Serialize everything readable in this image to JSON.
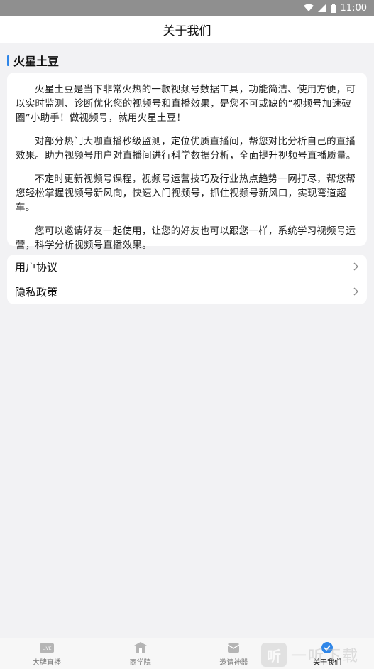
{
  "status_bar": {
    "time": "11:00",
    "icons": [
      "wifi-icon",
      "signal-icon",
      "battery-icon"
    ]
  },
  "header": {
    "title": "关于我们"
  },
  "section": {
    "title": "火星土豆",
    "accent_color": "#2f86e8"
  },
  "about": {
    "paragraphs": [
      "火星土豆是当下非常火热的一款视频号数据工具，功能简洁、使用方便，可以实时监测、诊断优化您的视频号和直播效果，是您不可或缺的“视频号加速破圈”小助手！做视频号，就用火星土豆！",
      "对部分热门大咖直播秒级监测，定位优质直播间，帮您对比分析自己的直播效果。助力视频号用户对直播间进行科学数据分析，全面提升视频号直播质量。",
      "不定时更新视频号课程，视频号运营技巧及行业热点趋势一网打尽，帮您帮您轻松掌握视频号新风向，快速入门视频号，抓住视频号新风口，实现弯道超车。",
      "您可以邀请好友一起使用，让您的好友也可以跟您一样，系统学习视频号运营，科学分析视频号直播效果。"
    ]
  },
  "links": [
    {
      "label": "用户协议",
      "icon": "chevron-right-icon"
    },
    {
      "label": "隐私政策",
      "icon": "chevron-right-icon"
    }
  ],
  "tabbar": {
    "tabs": [
      {
        "label": "大牌直播",
        "icon": "live-icon",
        "active": false
      },
      {
        "label": "商学院",
        "icon": "school-icon",
        "active": false
      },
      {
        "label": "邀请神器",
        "icon": "invite-icon",
        "active": false
      },
      {
        "label": "关于我们",
        "icon": "about-icon",
        "active": true
      }
    ]
  },
  "watermark": {
    "text": "一听下载",
    "logo_char": "听"
  }
}
